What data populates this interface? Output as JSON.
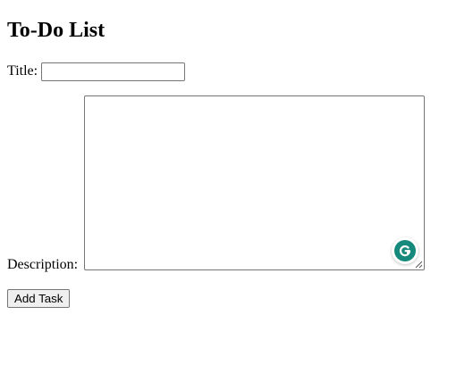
{
  "page": {
    "heading": "To-Do List"
  },
  "form": {
    "title_label": "Title:",
    "title_value": "",
    "title_placeholder": "",
    "description_label": "Description:",
    "description_value": "",
    "description_placeholder": "",
    "submit_label": "Add Task"
  },
  "widgets": {
    "grammarly_icon": "grammarly-g-icon",
    "grammarly_color": "#15897b"
  }
}
